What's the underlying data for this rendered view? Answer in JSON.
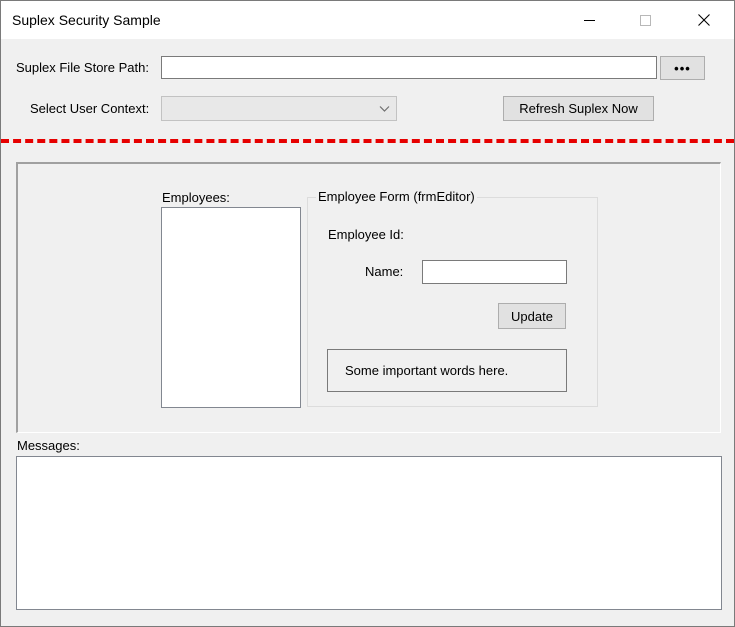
{
  "window": {
    "title": "Suplex Security Sample",
    "controls": [
      "minimize",
      "maximize",
      "close"
    ]
  },
  "toolbar": {
    "file_store_label": "Suplex File Store Path:",
    "file_store_value": "",
    "browse_button": "•••",
    "user_context_label": "Select User Context:",
    "user_context_value": "",
    "refresh_button": "Refresh Suplex Now"
  },
  "panel": {
    "employees_label": "Employees:",
    "employees": [],
    "editor": {
      "group_title": "Employee Form (frmEditor)",
      "employee_id_label": "Employee Id:",
      "employee_id_value": "",
      "name_label": "Name:",
      "name_value": "",
      "update_button": "Update",
      "note": "Some important words here."
    }
  },
  "messages": {
    "label": "Messages:",
    "text": ""
  },
  "colors": {
    "separator": "#e60000",
    "window_bg": "#f0f0f0"
  }
}
